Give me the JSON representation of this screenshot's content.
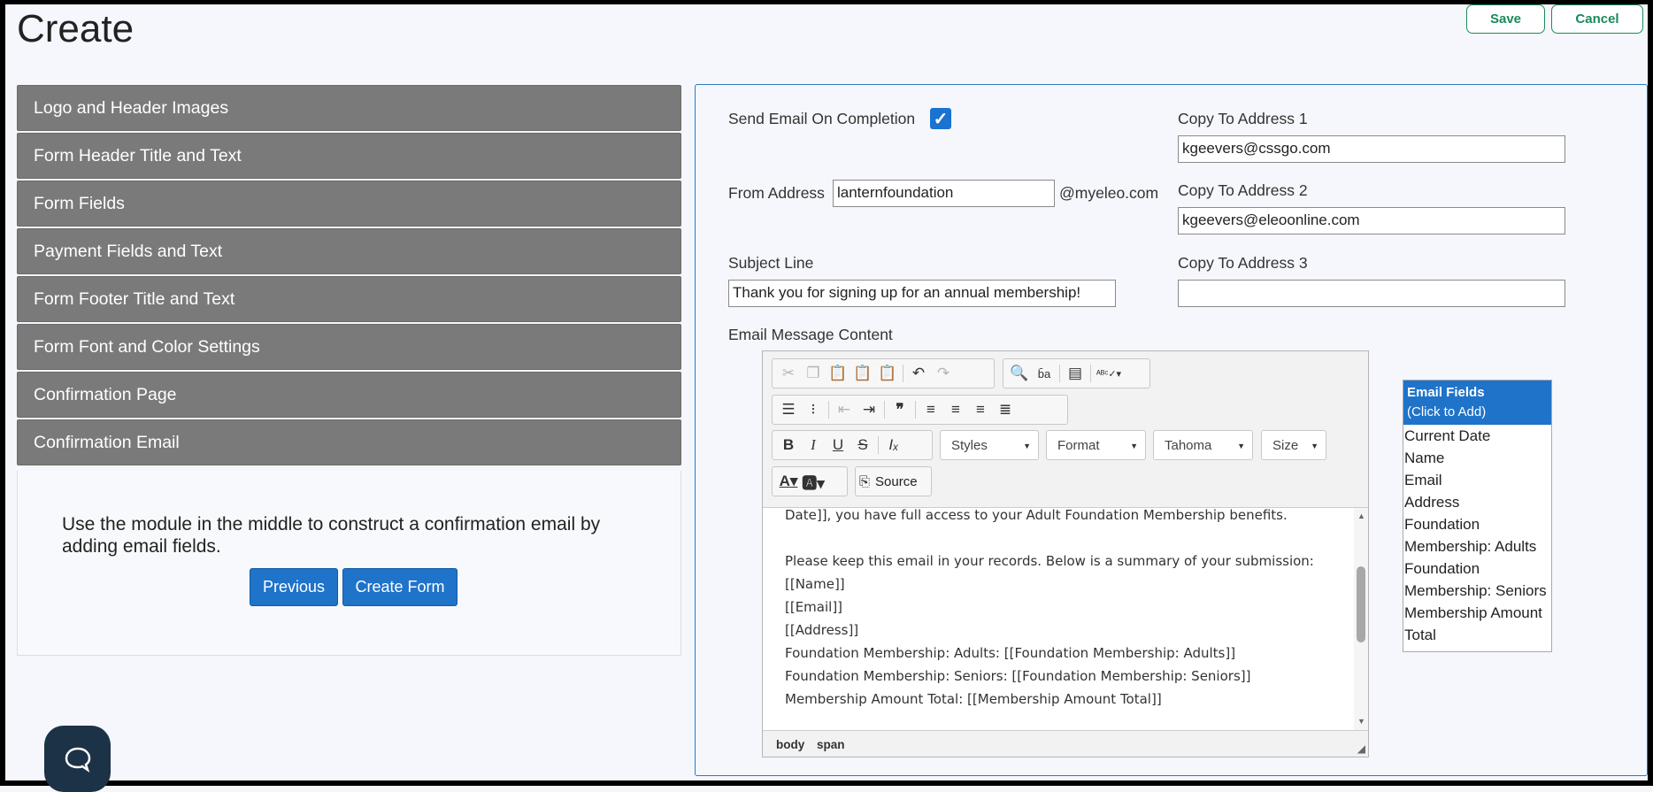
{
  "header": {
    "title": "Create",
    "save_label": "Save",
    "cancel_label": "Cancel"
  },
  "sidebar": {
    "items": [
      {
        "label": "Logo and Header Images"
      },
      {
        "label": "Form Header Title and Text"
      },
      {
        "label": "Form Fields"
      },
      {
        "label": "Payment Fields and Text"
      },
      {
        "label": "Form Footer Title and Text"
      },
      {
        "label": "Form Font and Color Settings"
      },
      {
        "label": "Confirmation Page"
      },
      {
        "label": "Confirmation Email"
      }
    ],
    "panel_message": "Use the module in the middle to construct a confirmation email by adding email fields.",
    "previous_label": "Previous",
    "create_form_label": "Create Form"
  },
  "form": {
    "send_email_label": "Send Email On Completion",
    "send_email_checked": true,
    "from_label": "From Address",
    "from_value": "lanternfoundation",
    "from_domain": "@myeleo.com",
    "subject_label": "Subject Line",
    "subject_value": "Thank you for signing up for an annual membership!",
    "copy1_label": "Copy To Address 1",
    "copy1_value": "kgeevers@cssgo.com",
    "copy2_label": "Copy To Address 2",
    "copy2_value": "kgeevers@eleoonline.com",
    "copy3_label": "Copy To Address 3",
    "copy3_value": "",
    "content_label": "Email Message Content"
  },
  "editor": {
    "styles_label": "Styles",
    "format_label": "Format",
    "font_label": "Tahoma",
    "size_label": "Size",
    "source_label": "Source",
    "lines": [
      "Date]], you have full access to your Adult Foundation Membership benefits.",
      "",
      "Please keep this email in your records.  Below is a summary of your submission:",
      "[[Name]]",
      "[[Email]]",
      "[[Address]]",
      "Foundation Membership: Adults: [[Foundation Membership: Adults]]",
      "Foundation Membership: Seniors: [[Foundation Membership: Seniors]]",
      "Membership Amount Total: [[Membership Amount Total]]"
    ],
    "path_body": "body",
    "path_span": "span"
  },
  "email_fields": {
    "title": "Email Fields",
    "subtitle": "(Click to Add)",
    "items": [
      "Current Date",
      "Name",
      "Email",
      "Address",
      "Foundation",
      "Membership: Adults",
      "Foundation",
      "Membership: Seniors",
      "Membership Amount",
      "Total"
    ]
  },
  "colors": {
    "accent": "#1f73c9",
    "save_green": "#1a8a5a",
    "accordion_gray": "#7a7a7a"
  }
}
